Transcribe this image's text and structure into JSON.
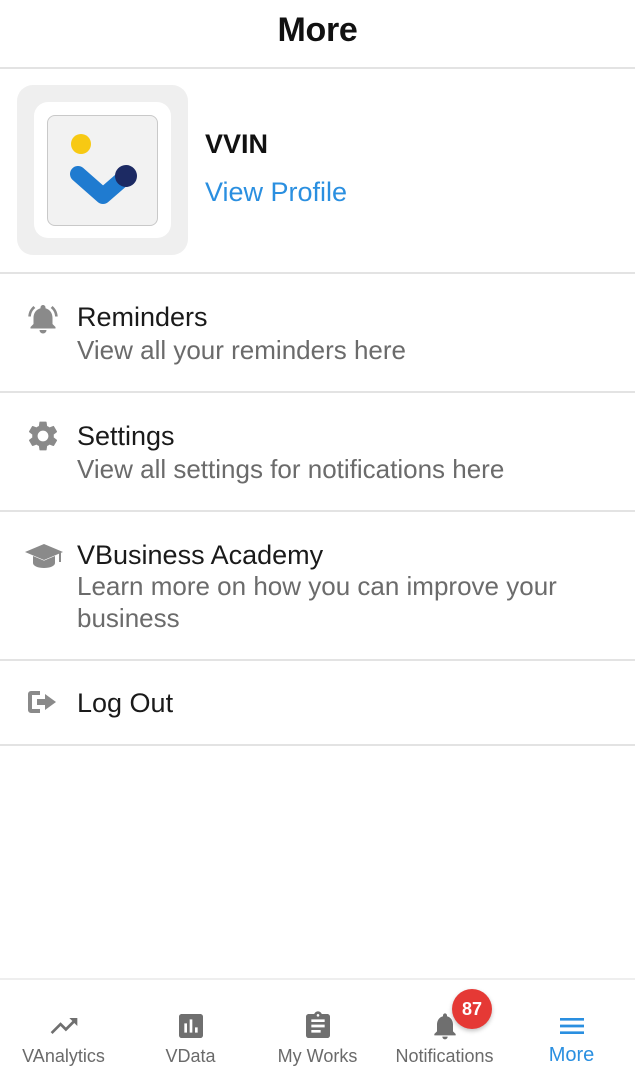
{
  "header": {
    "title": "More"
  },
  "profile": {
    "name": "VVIN",
    "view_profile_label": "View Profile"
  },
  "menu": {
    "reminders": {
      "title": "Reminders",
      "subtitle": "View all your reminders here",
      "icon": "bell-ring-icon"
    },
    "settings": {
      "title": "Settings",
      "subtitle": "View all settings for notifications here",
      "icon": "gear-icon"
    },
    "academy": {
      "title": "VBusiness Academy",
      "subtitle": "Learn more on how you can improve your business",
      "icon": "graduation-cap-icon"
    },
    "logout": {
      "title": "Log Out",
      "icon": "logout-icon"
    }
  },
  "bottom_nav": {
    "items": [
      {
        "label": "VAnalytics",
        "icon": "trending-up-icon"
      },
      {
        "label": "VData",
        "icon": "bar-chart-icon"
      },
      {
        "label": "My Works",
        "icon": "clipboard-icon"
      },
      {
        "label": "Notifications",
        "icon": "bell-icon",
        "badge": "87"
      },
      {
        "label": "More",
        "icon": "menu-icon",
        "active": true
      }
    ]
  },
  "colors": {
    "accent": "#2a8fe0",
    "badge": "#e53935",
    "icon_gray": "#8a8a8a",
    "logo_yellow": "#f7c913",
    "logo_blue": "#1f7bd0",
    "logo_navy": "#1c2a63"
  }
}
